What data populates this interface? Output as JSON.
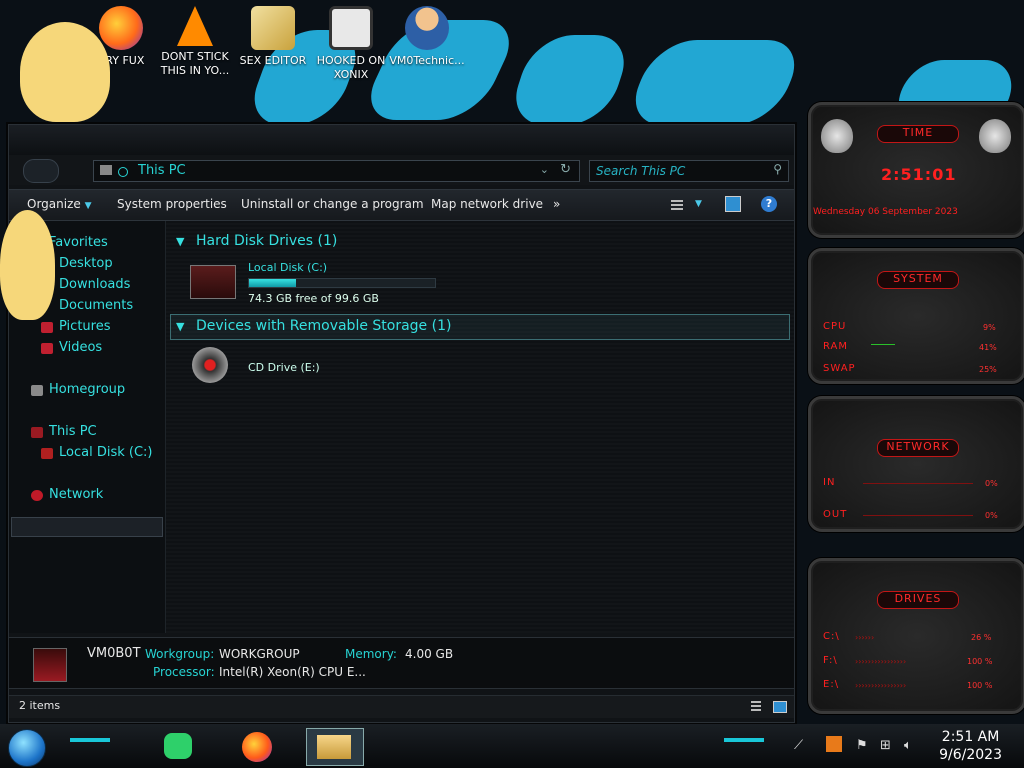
{
  "desktop": {
    "icons": [
      {
        "label": "RRY FUX",
        "name": "firefox-icon"
      },
      {
        "label": "DONT STICK THIS IN YO...",
        "name": "vlc-icon"
      },
      {
        "label": "SEX EDITOR",
        "name": "hex-editor-icon"
      },
      {
        "label": "HOOKED ON XONIX",
        "name": "xonix-icon"
      },
      {
        "label": "VM0Technic...",
        "name": "user-icon"
      }
    ]
  },
  "explorer": {
    "address": "This PC",
    "search_placeholder": "Search This PC",
    "toolbar": {
      "organize": "Organize",
      "system_properties": "System properties",
      "uninstall": "Uninstall or change a program",
      "map_drive": "Map network drive",
      "more": "»"
    },
    "nav": {
      "favorites": "Favorites",
      "desktop": "Desktop",
      "downloads": "Downloads",
      "documents": "Documents",
      "pictures": "Pictures",
      "videos": "Videos",
      "homegroup": "Homegroup",
      "this_pc": "This PC",
      "local_disk": "Local Disk (C:)",
      "network": "Network"
    },
    "groups": {
      "hdd": "Hard Disk Drives (1)",
      "removable": "Devices with Removable Storage (1)"
    },
    "drives": {
      "c_label": "Local Disk (C:)",
      "c_free": "74.3 GB free of 99.6 GB",
      "c_used_fraction": 0.254,
      "e_label": "CD Drive (E:)"
    },
    "details": {
      "computer_name": "VM0B0T",
      "workgroup_label": "Workgroup:",
      "workgroup": "WORKGROUP",
      "memory_label": "Memory:",
      "memory": "4.00 GB",
      "processor_label": "Processor:",
      "processor": "Intel(R) Xeon(R) CPU E..."
    },
    "status": "2 items"
  },
  "gadgets": {
    "time": {
      "title": "TIME",
      "clock": "2:51:01",
      "date": "Wednesday 06 September 2023"
    },
    "system": {
      "title": "SYSTEM",
      "cpu_label": "CPU",
      "cpu": "9%",
      "ram_label": "RAM",
      "ram": "41%",
      "swap_label": "SWAP",
      "swap": "25%"
    },
    "network": {
      "title": "NETWORK",
      "in_label": "IN",
      "in": "0%",
      "out_label": "OUT",
      "out": "0%"
    },
    "drives": {
      "title": "DRIVES",
      "c_label": "C:\\",
      "c": "26 %",
      "f_label": "F:\\",
      "f": "100 %",
      "e_label": "E:\\",
      "e": "100 %"
    }
  },
  "taskbar": {
    "time": "2:51 AM",
    "date": "9/6/2023"
  },
  "colors": {
    "accent": "#27d3d3",
    "gadget_red": "#ff2020",
    "wallpaper_blue": "#22a7d3"
  }
}
